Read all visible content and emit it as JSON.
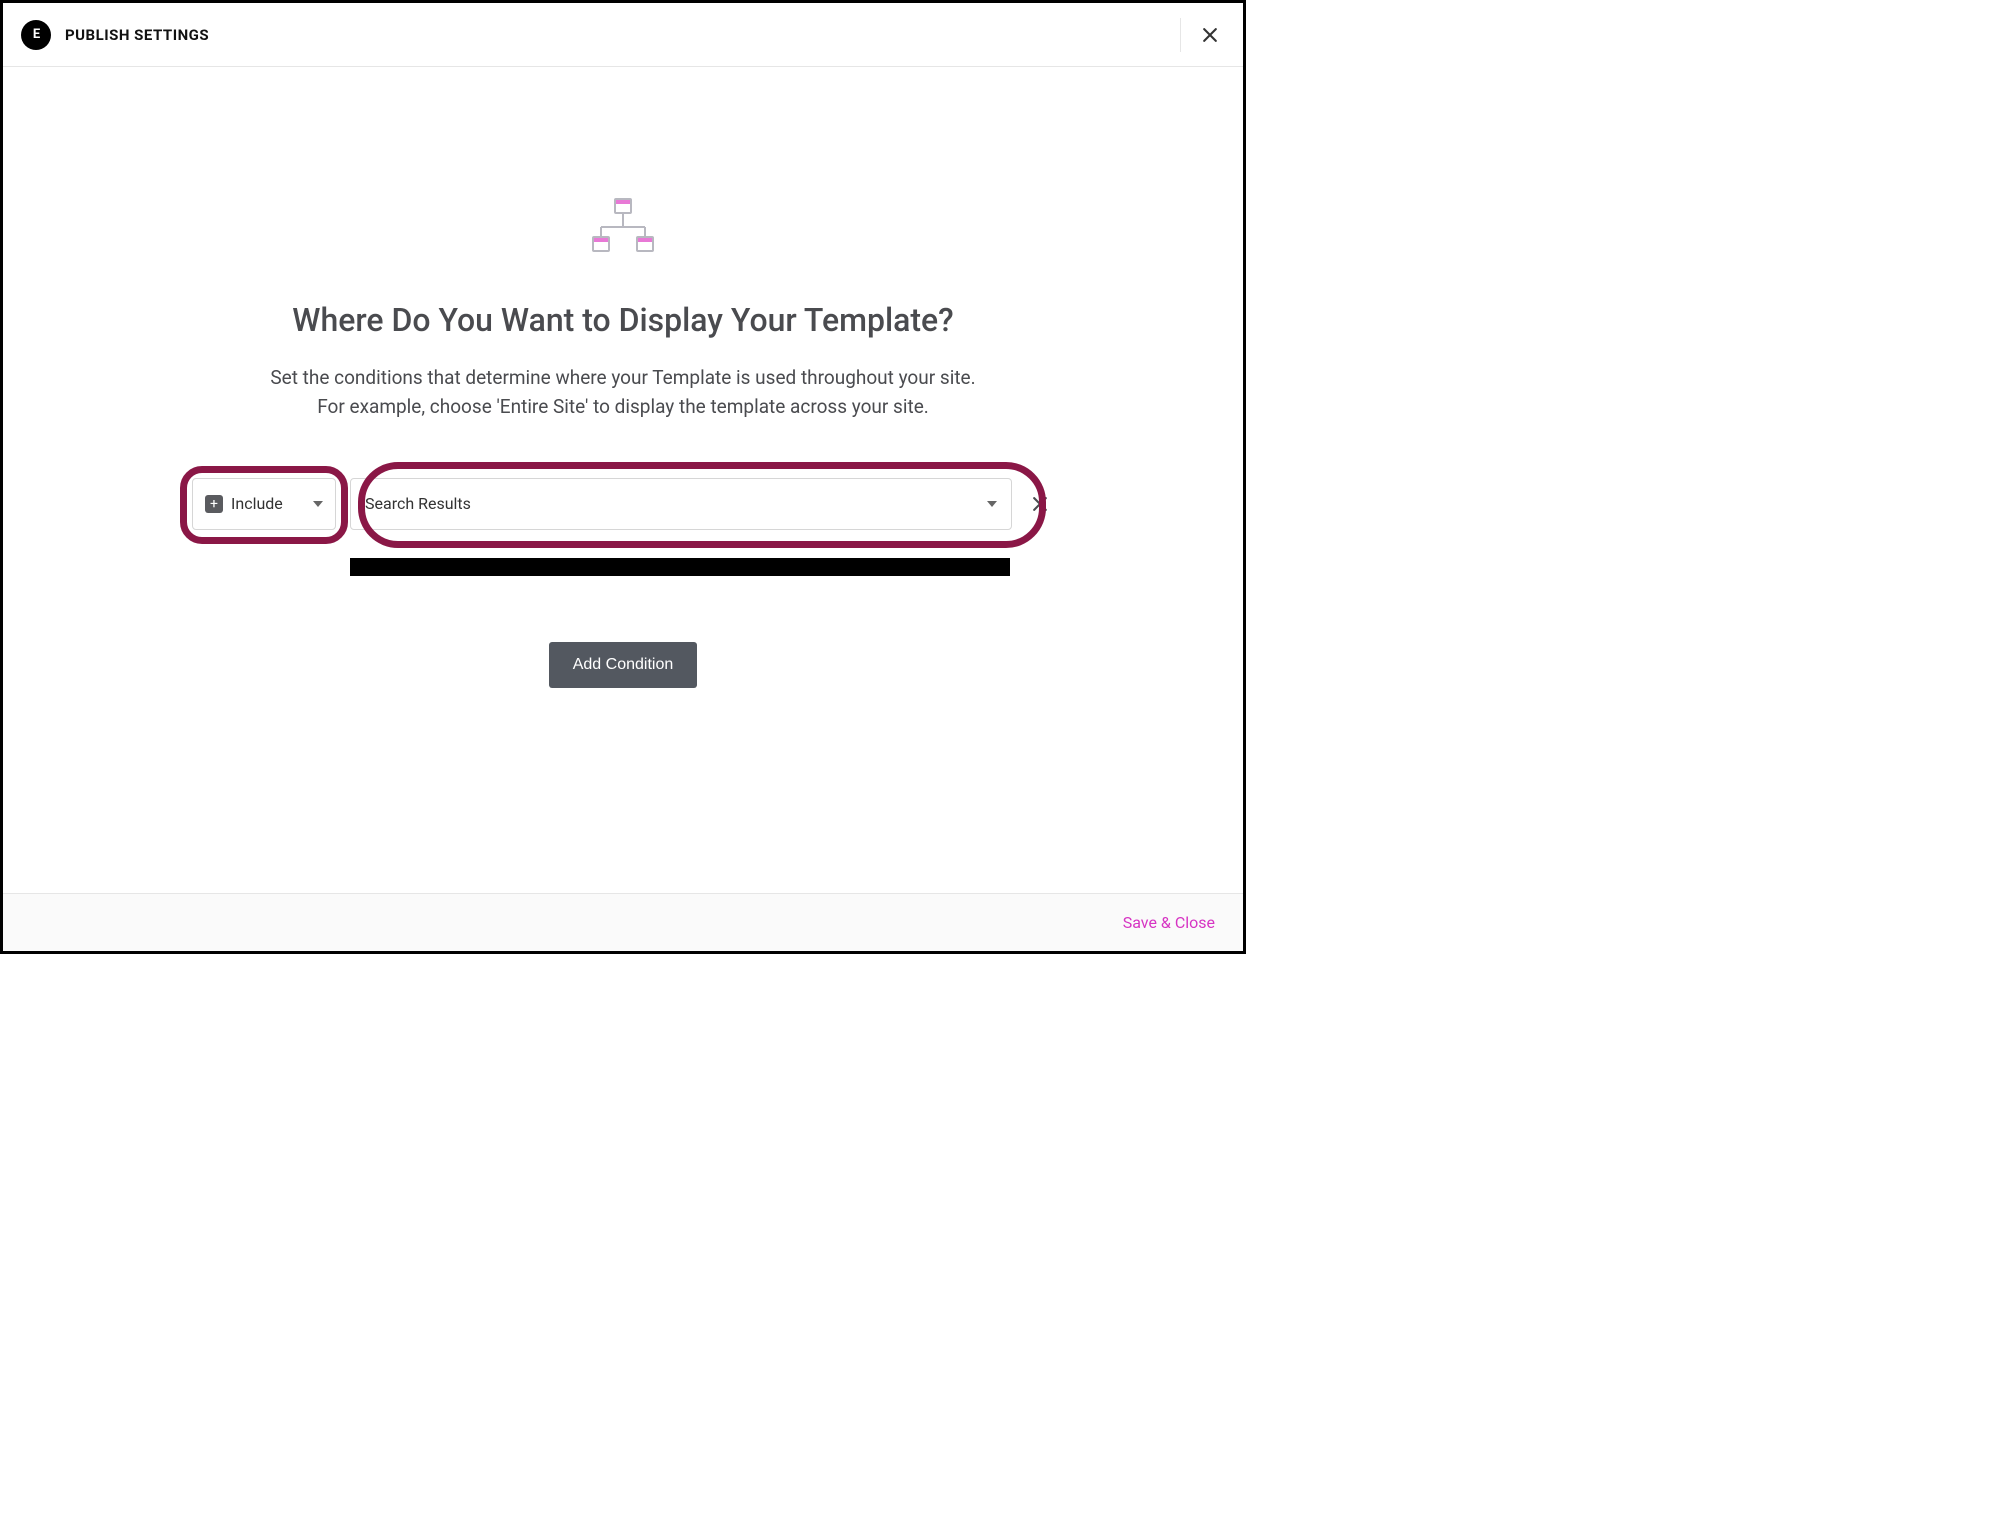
{
  "header": {
    "logo_text": "E",
    "title": "PUBLISH SETTINGS"
  },
  "main": {
    "heading": "Where Do You Want to Display Your Template?",
    "description_line1": "Set the conditions that determine where your Template is used throughout your site.",
    "description_line2": "For example, choose 'Entire Site' to display the template across your site."
  },
  "condition": {
    "include_label": "Include",
    "location_value": "Search Results"
  },
  "actions": {
    "add_condition": "Add Condition",
    "save_close": "Save & Close"
  },
  "icons": {
    "close": "close-icon",
    "sitemap": "sitemap-icon",
    "plus": "plus-icon",
    "caret": "caret-down-icon",
    "remove": "remove-icon"
  },
  "colors": {
    "highlight": "#8a1746",
    "accent": "#d634c3",
    "button_bg": "#535860"
  }
}
